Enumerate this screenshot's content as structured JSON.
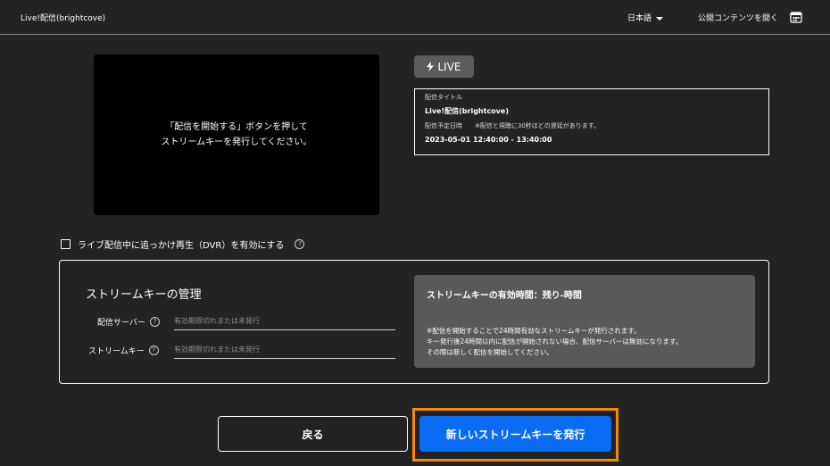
{
  "header": {
    "app_title": "Live!配信(brightcove)",
    "language": "日本語",
    "open_public": "公開コンテンツを開く",
    "public_icon": "calendar-icon"
  },
  "player": {
    "line1": "「配信を開始する」ボタンを押して",
    "line2": "ストリームキーを発行してください。"
  },
  "live_badge": {
    "label": "LIVE",
    "icon": "bolt-icon"
  },
  "info": {
    "title_label": "配信タイトル",
    "title": "Live!配信(brightcove)",
    "schedule_label": "配信予定日時",
    "delay_note": "※配信と視聴に30秒ほどの遅延があります。",
    "schedule": "2023-05-01 12:40:00 - 13:40:00"
  },
  "dvr": {
    "label": "ライブ配信中に追っかけ再生（DVR）を有効にする"
  },
  "stream_key": {
    "heading": "ストリームキーの管理",
    "server_label": "配信サーバー",
    "server_value": "有効期限切れまたは未発行",
    "key_label": "ストリームキー",
    "key_value": "有効期限切れまたは未発行",
    "validity_title": "ストリームキーの有効時間：残り-時間",
    "notes": [
      "※配信を開始することで24時間有効なストリームキーが発行されます。",
      "キー発行後24時間以内に配信が開始されない場合、配信サーバーは無効になります。",
      "その際は新しく配信を開始してください。"
    ]
  },
  "buttons": {
    "back": "戻る",
    "issue": "新しいストリームキーを発行"
  },
  "colors": {
    "background": "#232323",
    "primary": "#0a6cf5",
    "highlight": "#f58a07"
  }
}
